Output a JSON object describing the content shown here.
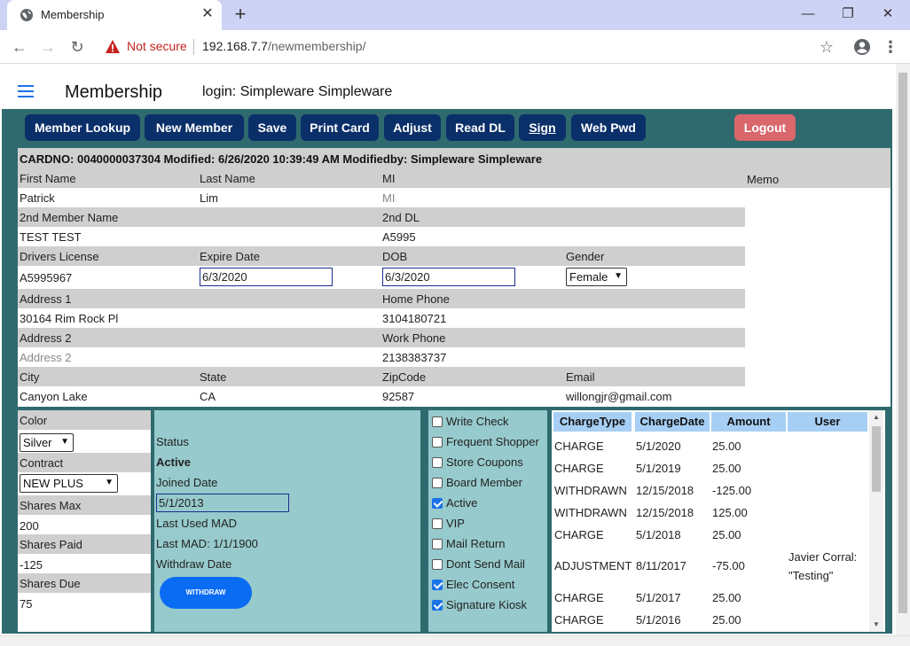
{
  "browser": {
    "tab_title": "Membership",
    "close": "✕",
    "newtab": "+",
    "not_secure": "Not secure",
    "url_host": "192.168.7.7",
    "url_path": "/newmembership/"
  },
  "header": {
    "title": "Membership",
    "login": "login: Simpleware Simpleware"
  },
  "toolbar": {
    "member_lookup": "Member Lookup",
    "new_member": "New Member",
    "save": "Save",
    "print_card": "Print Card",
    "adjust": "Adjust",
    "read_dl": "Read DL",
    "sign": "Sign",
    "web_pwd": "Web Pwd",
    "logout": "Logout"
  },
  "member": {
    "header": "CARDNO: 0040000037304 Modified: 6/26/2020 10:39:49 AM Modifiedby: Simpleware Simpleware",
    "labels": {
      "first_name": "First Name",
      "last_name": "Last Name",
      "mi": "MI",
      "memo": "Memo",
      "second_member_name": "2nd Member Name",
      "second_dl": "2nd DL",
      "drivers_license": "Drivers License",
      "expire_date": "Expire Date",
      "dob": "DOB",
      "gender": "Gender",
      "address1": "Address 1",
      "home_phone": "Home Phone",
      "address2": "Address 2",
      "work_phone": "Work Phone",
      "city": "City",
      "state": "State",
      "zipcode": "ZipCode",
      "email": "Email"
    },
    "values": {
      "first_name": "Patrick",
      "last_name": "Lim",
      "mi_placeholder": "MI",
      "second_member_name": "TEST TEST",
      "second_dl": "A5995",
      "drivers_license": "A5995967",
      "expire_date": "6/3/2020",
      "dob": "6/3/2020",
      "gender": "Female",
      "address1": "30164 Rim Rock Pl",
      "home_phone": "3104180721",
      "address2_placeholder": "Address 2",
      "work_phone": "2138383737",
      "city": "Canyon Lake",
      "state": "CA",
      "zipcode": "92587",
      "email": "willongjr@gmail.com"
    }
  },
  "shares": {
    "color_label": "Color",
    "color": "Silver",
    "contract_label": "Contract",
    "contract": "NEW PLUS",
    "max_label": "Shares Max",
    "max": "200",
    "paid_label": "Shares Paid",
    "paid": "-125",
    "due_label": "Shares Due",
    "due": "75"
  },
  "status": {
    "status_label": "Status",
    "status": "Active",
    "joined_label": "Joined Date",
    "joined": "5/1/2013",
    "last_used_mad": "Last Used MAD",
    "last_mad": "Last MAD: 1/1/1900",
    "withdraw_date": "Withdraw Date",
    "withdraw_button": "WITHDRAW"
  },
  "options": [
    {
      "label": "Write Check",
      "checked": false
    },
    {
      "label": "Frequent Shopper",
      "checked": false
    },
    {
      "label": "Store Coupons",
      "checked": false
    },
    {
      "label": "Board Member",
      "checked": false
    },
    {
      "label": "Active",
      "checked": true
    },
    {
      "label": "VIP",
      "checked": false
    },
    {
      "label": "Mail Return",
      "checked": false
    },
    {
      "label": "Dont Send Mail",
      "checked": false
    },
    {
      "label": "Elec Consent",
      "checked": true
    },
    {
      "label": "Signature Kiosk",
      "checked": true
    }
  ],
  "charges": {
    "headers": [
      "ChargeType",
      "ChargeDate",
      "Amount",
      "User"
    ],
    "rows": [
      {
        "type": "CHARGE",
        "date": "5/1/2020",
        "amount": "25.00",
        "user1": "",
        "user2": ""
      },
      {
        "type": "CHARGE",
        "date": "5/1/2019",
        "amount": "25.00",
        "user1": "",
        "user2": ""
      },
      {
        "type": "WITHDRAWN",
        "date": "12/15/2018",
        "amount": "-125.00",
        "user1": "",
        "user2": ""
      },
      {
        "type": "WITHDRAWN",
        "date": "12/15/2018",
        "amount": "125.00",
        "user1": "",
        "user2": ""
      },
      {
        "type": "CHARGE",
        "date": "5/1/2018",
        "amount": "25.00",
        "user1": "",
        "user2": ""
      },
      {
        "type": "ADJUSTMENT",
        "date": "8/11/2017",
        "amount": "-75.00",
        "user1": "Javier Corral:",
        "user2": "\"Testing\""
      },
      {
        "type": "CHARGE",
        "date": "5/1/2017",
        "amount": "25.00",
        "user1": "",
        "user2": ""
      },
      {
        "type": "CHARGE",
        "date": "5/1/2016",
        "amount": "25.00",
        "user1": "",
        "user2": ""
      }
    ]
  }
}
